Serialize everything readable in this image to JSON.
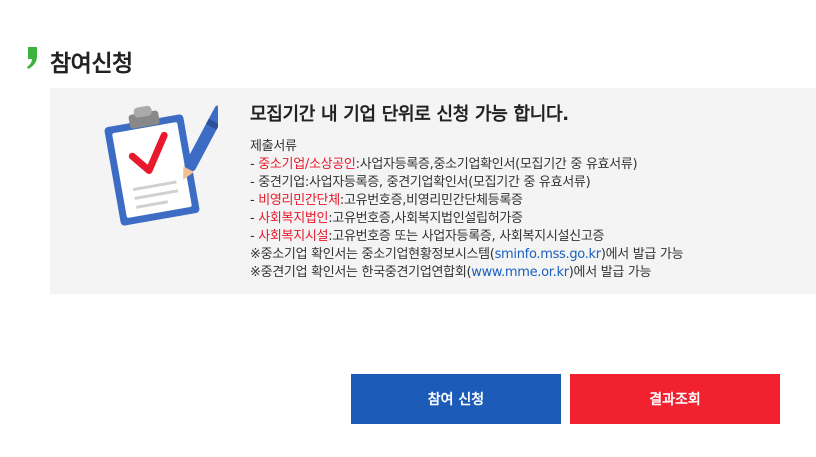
{
  "section": {
    "title": "참여신청"
  },
  "info": {
    "headline": "모집기간 내 기업 단위로 신청 가능 합니다.",
    "docs_title": "제출서류",
    "items": [
      {
        "prefix": "- ",
        "category": "중소기업/소상공인",
        "text": ":사업자등록증,중소기업확인서(모집기간 중 유효서류)",
        "highlight": true
      },
      {
        "prefix": "- ",
        "category": "중견기업",
        "text": ":사업자등록증, 중견기업확인서(모집기간 중 유효서류)",
        "highlight": false
      },
      {
        "prefix": "- ",
        "category": "비영리민간단체",
        "text": ":고유번호증,비영리민간단체등록증",
        "highlight": true
      },
      {
        "prefix": "- ",
        "category": "사회복지법인",
        "text": ":고유번호증,사회복지법인설립허가증",
        "highlight": true
      },
      {
        "prefix": "- ",
        "category": "사회복지시설",
        "text": ":고유번호증 또는 사업자등록증, 사회복지시설신고증",
        "highlight": true
      }
    ],
    "notes": [
      {
        "before": "※중소기업 확인서는 중소기업현황정보시스템(",
        "link": "sminfo.mss.go.kr",
        "after": ")에서 발급 가능"
      },
      {
        "before": "※중견기업 확인서는 한국중견기업연합회(",
        "link": "www.mme.or.kr",
        "after": ")에서 발급 가능"
      }
    ]
  },
  "buttons": {
    "apply": "참여 신청",
    "result": "결과조회"
  },
  "colors": {
    "brand_green": "#3db23d",
    "primary_blue": "#1c5bb8",
    "accent_red": "#f2212f",
    "box_bg": "#f4f4f4"
  },
  "icons": {
    "header": "green-quote-icon",
    "illustration": "clipboard-checklist-icon"
  }
}
